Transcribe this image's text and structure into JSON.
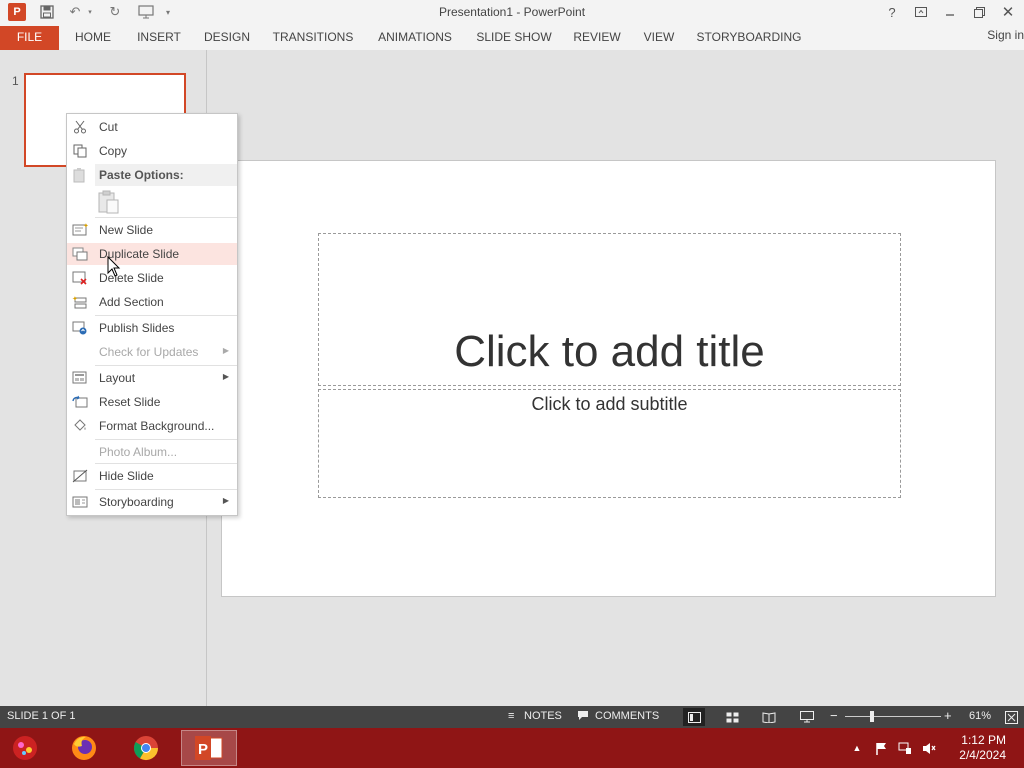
{
  "window": {
    "title": "Presentation1 - PowerPoint",
    "controls": [
      "?",
      "restore-ribbon",
      "minimize",
      "restore",
      "close"
    ]
  },
  "ribbon": {
    "file_label": "FILE",
    "tabs": [
      "HOME",
      "INSERT",
      "DESIGN",
      "TRANSITIONS",
      "ANIMATIONS",
      "SLIDE SHOW",
      "REVIEW",
      "VIEW",
      "STORYBOARDING"
    ],
    "sign_in": "Sign in"
  },
  "thumbnails": {
    "items": [
      {
        "number": "1",
        "selected": true
      }
    ]
  },
  "slide": {
    "title_placeholder": "Click to add title",
    "subtitle_placeholder": "Click to add subtitle"
  },
  "context_menu": {
    "cut": "Cut",
    "copy": "Copy",
    "paste_options": "Paste Options:",
    "new_slide": "New Slide",
    "duplicate_slide": "Duplicate Slide",
    "delete_slide": "Delete Slide",
    "add_section": "Add Section",
    "publish_slides": "Publish Slides",
    "check_for_updates": "Check for Updates",
    "layout": "Layout",
    "reset_slide": "Reset Slide",
    "format_background": "Format Background...",
    "photo_album": "Photo Album...",
    "hide_slide": "Hide Slide",
    "storyboarding": "Storyboarding"
  },
  "statusbar": {
    "slide_counter": "SLIDE 1 OF 1",
    "notes": "NOTES",
    "comments": "COMMENTS",
    "zoom_minus": "−",
    "zoom_plus": "+",
    "zoom_level": "61%"
  },
  "taskbar": {
    "time": "1:12 PM",
    "date": "2/4/2024"
  },
  "colors": {
    "accent": "#d24726",
    "taskbar": "#8f1515",
    "statusbar": "#444444",
    "hover": "#fce4e0"
  }
}
